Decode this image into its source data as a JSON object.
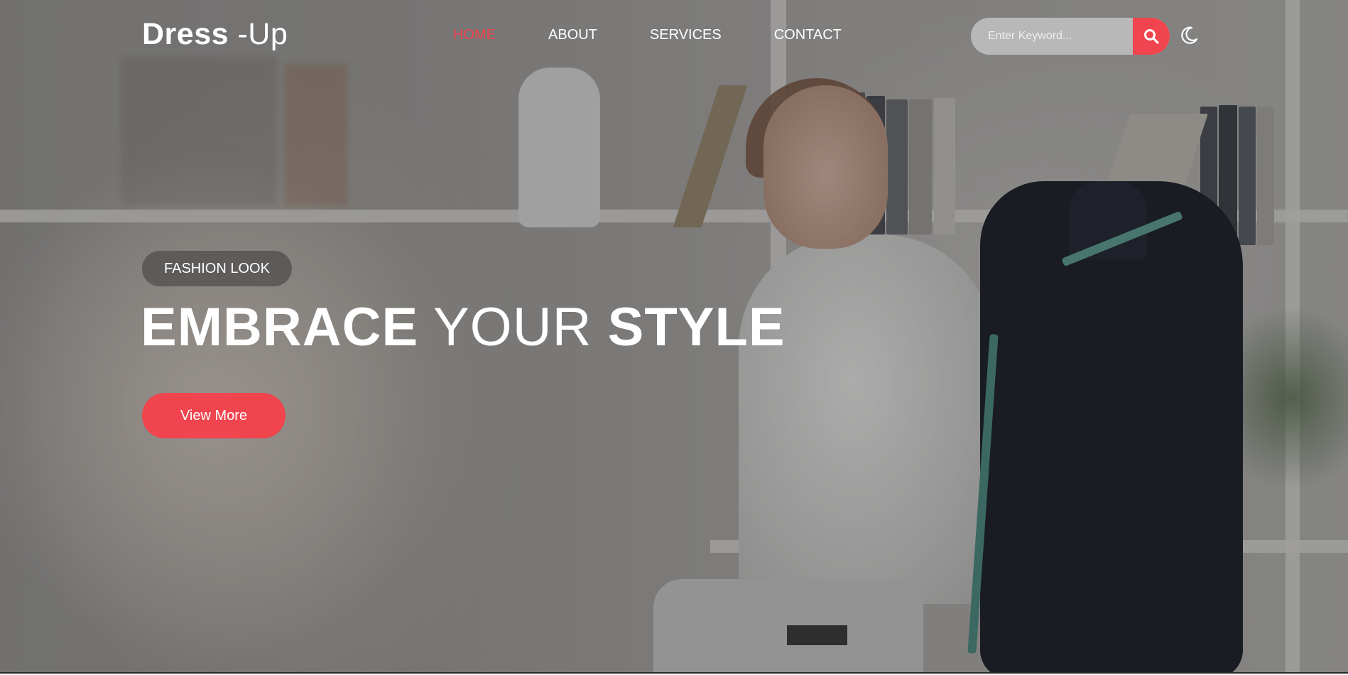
{
  "brand": {
    "bold": "Dress",
    "thin": " -Up"
  },
  "nav": {
    "items": [
      {
        "label": "HOME",
        "active": true
      },
      {
        "label": "ABOUT",
        "active": false
      },
      {
        "label": "SERVICES",
        "active": false
      },
      {
        "label": "CONTACT",
        "active": false
      }
    ]
  },
  "search": {
    "placeholder": "Enter Keyword...",
    "value": "",
    "button_icon": "search-icon"
  },
  "theme_toggle": {
    "icon": "moon-icon"
  },
  "hero": {
    "tag": "FASHION LOOK",
    "headline": {
      "part1": "EMBRACE",
      "part2": " YOUR ",
      "part3": "STYLE"
    },
    "cta": "View More"
  },
  "colors": {
    "accent": "#f0444e",
    "text": "#ffffff"
  }
}
